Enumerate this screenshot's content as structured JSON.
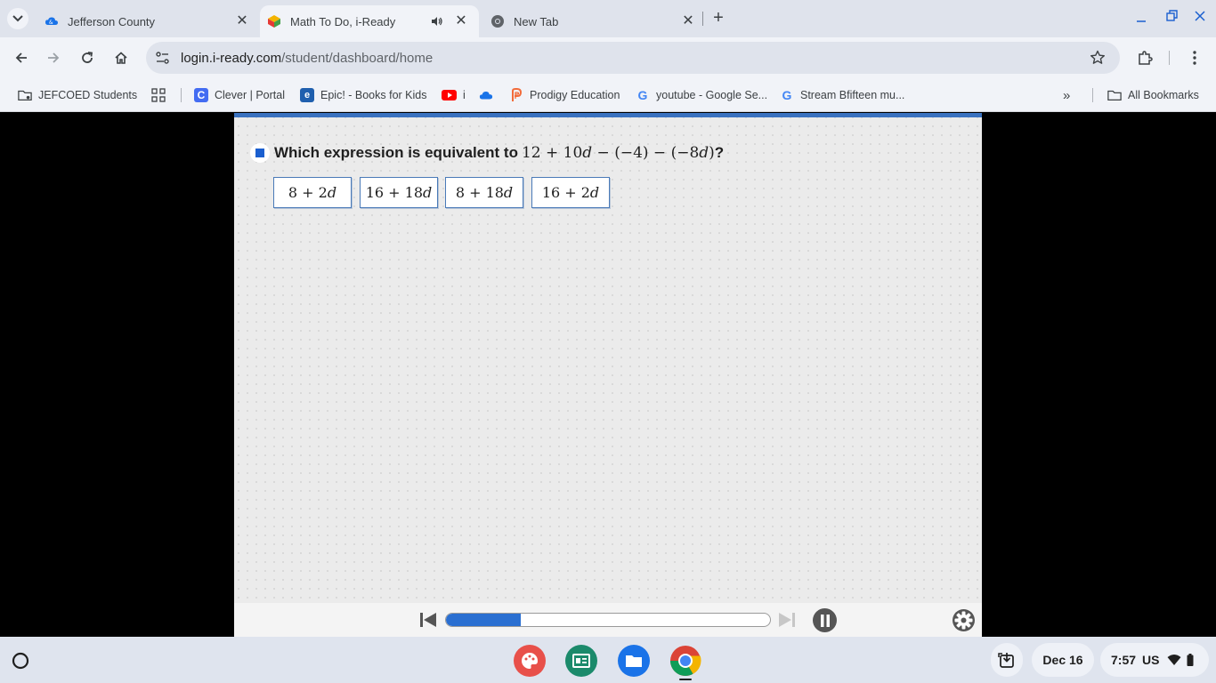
{
  "tabs": [
    {
      "label": "Jefferson County",
      "icon": "cloud-icon"
    },
    {
      "label": "Math To Do, i-Ready",
      "icon": "iready-icon",
      "audio": true
    },
    {
      "label": "New Tab",
      "icon": "chrome-icon"
    }
  ],
  "address": {
    "host": "login.i-ready.com",
    "path": "/student/dashboard/home"
  },
  "bookmarks": [
    {
      "label": "JEFCOED Students",
      "icon": "folder-icon"
    },
    {
      "label": "",
      "icon": "apps-grid-icon"
    },
    {
      "label": "Clever | Portal",
      "icon": "clever-icon"
    },
    {
      "label": "Epic! - Books for Kids",
      "icon": "epic-icon"
    },
    {
      "label": "i",
      "icon": "youtube-icon"
    },
    {
      "label": "",
      "icon": "cloud-icon"
    },
    {
      "label": "Prodigy Education",
      "icon": "prodigy-icon"
    },
    {
      "label": "youtube - Google Se...",
      "icon": "google-icon"
    },
    {
      "label": "Stream Bfifteen mu...",
      "icon": "google-icon"
    },
    {
      "label": "All Bookmarks",
      "icon": "folder-icon"
    }
  ],
  "question": {
    "text": "Which expression is equivalent to",
    "expression": "12 + 10𝑑 − (−4) − (−8𝑑)",
    "end": "?"
  },
  "choices": [
    "8 + 2𝑑",
    "16 + 18𝑑",
    "8 + 18𝑑",
    "16 + 2𝑑"
  ],
  "player": {
    "progress": 0.23
  },
  "shelf": {
    "date": "Dec 16",
    "time": "7:57",
    "locale": "US"
  },
  "colors": {
    "accent": "#2a6fd1",
    "tabstrip": "#dfe3ec",
    "toolbar": "#f1f3f8"
  }
}
